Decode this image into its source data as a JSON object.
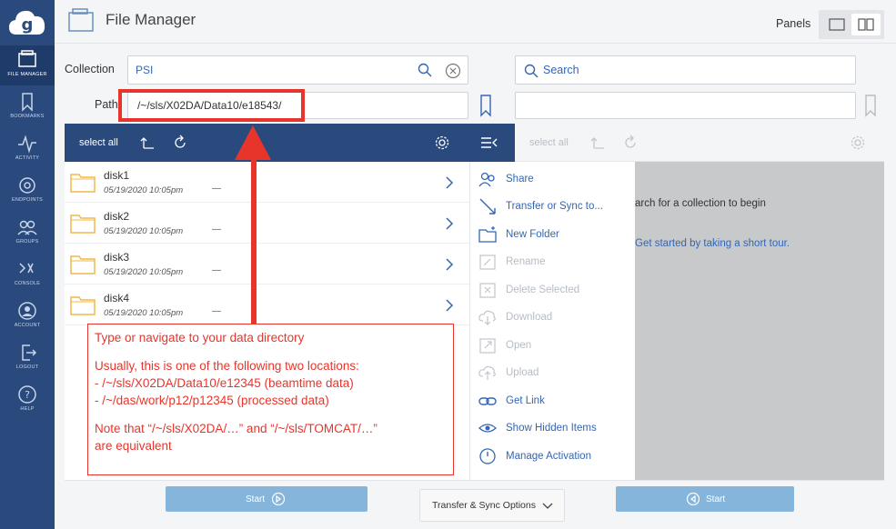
{
  "nav": {
    "items": [
      {
        "label": "FILE MANAGER",
        "icon": "file-manager-icon"
      },
      {
        "label": "BOOKMARKS",
        "icon": "bookmark-icon"
      },
      {
        "label": "ACTIVITY",
        "icon": "activity-icon"
      },
      {
        "label": "ENDPOINTS",
        "icon": "endpoints-icon"
      },
      {
        "label": "GROUPS",
        "icon": "groups-icon"
      },
      {
        "label": "CONSOLE",
        "icon": "console-icon"
      },
      {
        "label": "ACCOUNT",
        "icon": "account-icon"
      },
      {
        "label": "LOGOUT",
        "icon": "logout-icon"
      },
      {
        "label": "HELP",
        "icon": "help-icon"
      }
    ]
  },
  "header": {
    "title": "File Manager",
    "panels_label": "Panels"
  },
  "left": {
    "collection_label": "Collection",
    "collection_value": "PSI",
    "path_label": "Path",
    "path_value": "/~/sls/X02DA/Data10/e18543/",
    "select_all": "select all",
    "files": [
      {
        "name": "disk1",
        "date": "05/19/2020 10:05pm",
        "size": "—"
      },
      {
        "name": "disk2",
        "date": "05/19/2020 10:05pm",
        "size": "—"
      },
      {
        "name": "disk3",
        "date": "05/19/2020 10:05pm",
        "size": "—"
      },
      {
        "name": "disk4",
        "date": "05/19/2020 10:05pm",
        "size": "—"
      }
    ]
  },
  "actions": [
    {
      "label": "Share",
      "icon": "share-icon",
      "enabled": true
    },
    {
      "label": "Transfer or Sync to...",
      "icon": "transfer-icon",
      "enabled": true
    },
    {
      "label": "New Folder",
      "icon": "new-folder-icon",
      "enabled": true
    },
    {
      "label": "Rename",
      "icon": "rename-icon",
      "enabled": false
    },
    {
      "label": "Delete Selected",
      "icon": "delete-icon",
      "enabled": false
    },
    {
      "label": "Download",
      "icon": "download-icon",
      "enabled": false
    },
    {
      "label": "Open",
      "icon": "open-icon",
      "enabled": false
    },
    {
      "label": "Upload",
      "icon": "upload-icon",
      "enabled": false
    },
    {
      "label": "Get Link",
      "icon": "link-icon",
      "enabled": true
    },
    {
      "label": "Show Hidden Items",
      "icon": "eye-icon",
      "enabled": true
    },
    {
      "label": "Manage Activation",
      "icon": "power-icon",
      "enabled": true
    }
  ],
  "right": {
    "search_placeholder": "Search",
    "select_all": "select all",
    "message": "arch for a collection to begin",
    "tour_link": "Get started by taking a short tour."
  },
  "bottom": {
    "start_left": "Start",
    "options": "Transfer & Sync Options",
    "start_right": "Start"
  },
  "annotation": {
    "line1": "Type or navigate to your data directory",
    "line2": "Usually, this is one of the following two locations:",
    "line3": "-  /~/sls/X02DA/Data10/e12345    (beamtime data)",
    "line4": "-  /~/das/work/p12/p12345          (processed data)",
    "line5": "Note that “/~/sls/X02DA/…” and “/~/sls/TOMCAT/…”",
    "line6": "are equivalent"
  },
  "colors": {
    "nav": "#2a4a7d",
    "accent": "#3366b3",
    "annotation": "#e8352b",
    "start_button": "#85b5db",
    "folder": "#f0b84a"
  }
}
